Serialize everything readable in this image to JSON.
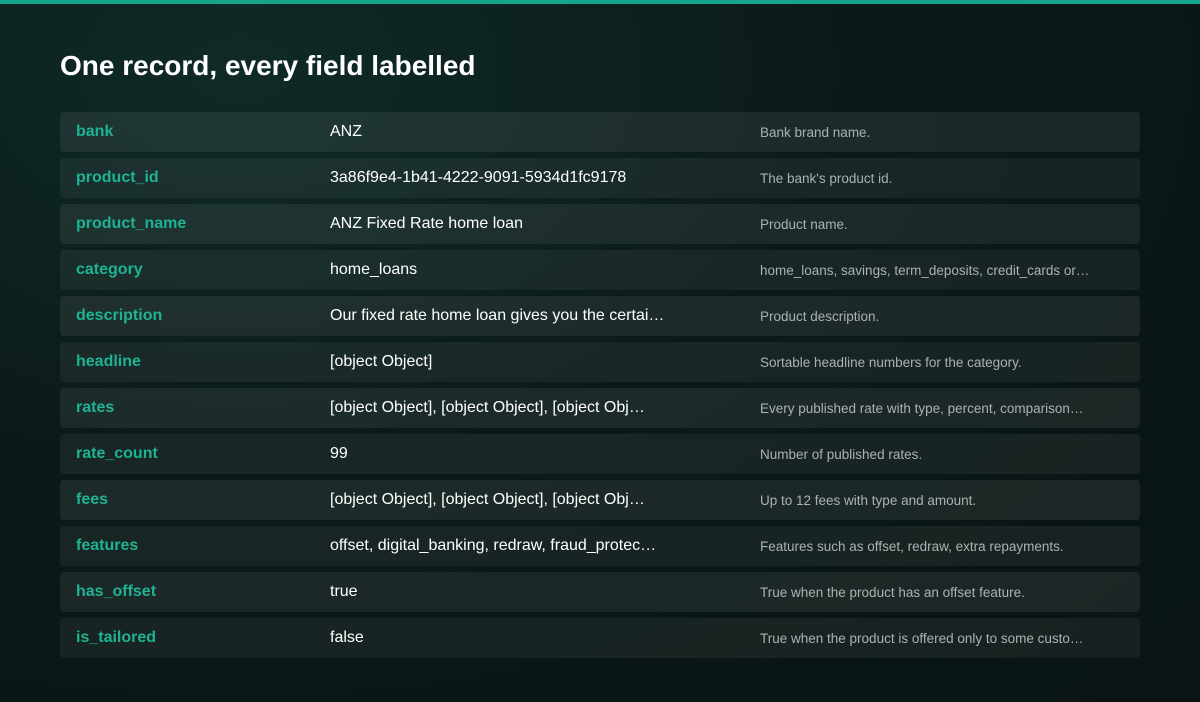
{
  "page": {
    "title": "One record, every field labelled"
  },
  "colors": {
    "accent": "#14a58a",
    "key_text": "#1fb393",
    "value_text": "#ffffff",
    "description_text": "#a9b3b1",
    "background": "#0b1a19"
  },
  "record": {
    "rows": [
      {
        "key": "bank",
        "value": "ANZ",
        "description": "Bank brand name."
      },
      {
        "key": "product_id",
        "value": "3a86f9e4-1b41-4222-9091-5934d1fc9178",
        "description": "The bank's product id."
      },
      {
        "key": "product_name",
        "value": "ANZ Fixed Rate home loan",
        "description": "Product name."
      },
      {
        "key": "category",
        "value": "home_loans",
        "description": "home_loans, savings, term_deposits, credit_cards or…"
      },
      {
        "key": "description",
        "value": "Our fixed rate home loan gives you the certai…",
        "description": "Product description."
      },
      {
        "key": "headline",
        "value": "[object Object]",
        "description": "Sortable headline numbers for the category."
      },
      {
        "key": "rates",
        "value": "[object Object], [object Object], [object Obj…",
        "description": "Every published rate with type, percent, comparison…"
      },
      {
        "key": "rate_count",
        "value": "99",
        "description": "Number of published rates."
      },
      {
        "key": "fees",
        "value": "[object Object], [object Object], [object Obj…",
        "description": "Up to 12 fees with type and amount."
      },
      {
        "key": "features",
        "value": "offset, digital_banking, redraw, fraud_protec…",
        "description": "Features such as offset, redraw, extra repayments."
      },
      {
        "key": "has_offset",
        "value": "true",
        "description": "True when the product has an offset feature."
      },
      {
        "key": "is_tailored",
        "value": "false",
        "description": "True when the product is offered only to some custo…"
      }
    ]
  }
}
